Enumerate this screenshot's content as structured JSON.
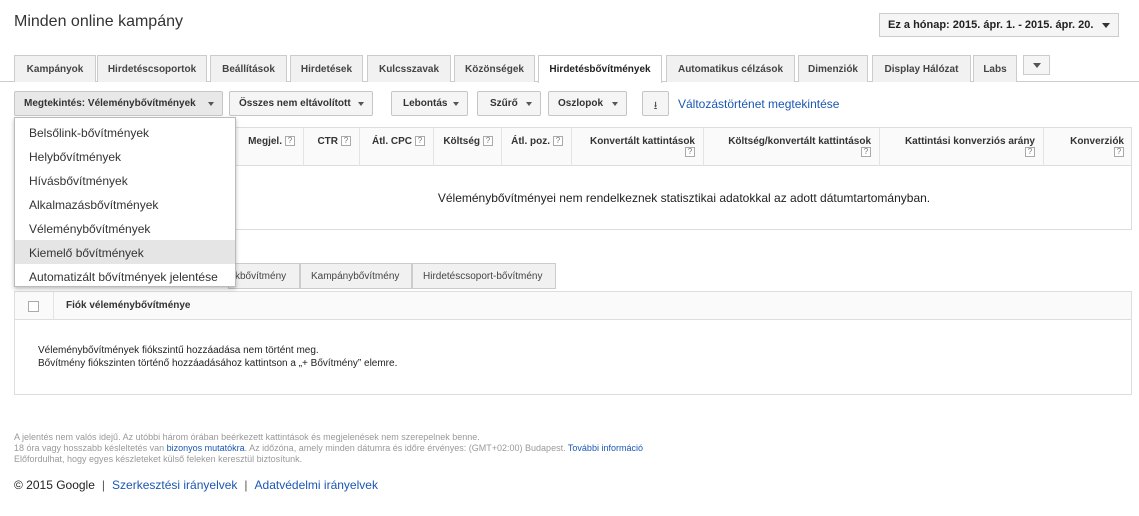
{
  "header": {
    "title": "Minden online kampány",
    "date_range": "Ez a hónap: 2015. ápr. 1. - 2015. ápr. 20."
  },
  "tabs": [
    {
      "label": "Kampányok"
    },
    {
      "label": "Hirdetéscsoportok"
    },
    {
      "label": "Beállítások"
    },
    {
      "label": "Hirdetések"
    },
    {
      "label": "Kulcsszavak"
    },
    {
      "label": "Közönségek"
    },
    {
      "label": "Hirdetésbővítmények",
      "active": true
    },
    {
      "label": "Automatikus célzások"
    },
    {
      "label": "Dimenziók"
    },
    {
      "label": "Display Hálózat"
    },
    {
      "label": "Labs"
    }
  ],
  "toolbar": {
    "view_button": "Megtekintés: Véleménybővítmények",
    "filter_all": "Összes nem eltávolított",
    "segment": "Lebontás",
    "filter": "Szűrő",
    "columns": "Oszlopok",
    "history_link": "Változástörténet megtekintése"
  },
  "view_menu": {
    "items": [
      "Belsőlink-bővítmények",
      "Helybővítmények",
      "Hívásbővítmények",
      "Alkalmazásbővítmények",
      "Véleménybővítmények",
      "Kiemelő bővítmények",
      "Automatizált bővítmények jelentése"
    ],
    "hovered": "Kiemelő bővítmények"
  },
  "stats_table": {
    "columns": [
      "Megjel.",
      "CTR",
      "Átl. CPC",
      "Költség",
      "Átl. poz.",
      "Konvertált kattintások",
      "Költség/konvertált kattintások",
      "Kattintási konverziós arány",
      "Konverziók"
    ],
    "empty_message": "Véleménybővítményei nem rendelkeznek statisztikai adatokkal az adott dátumtartományban."
  },
  "sub_tabs": [
    {
      "label": "kbővítmény"
    },
    {
      "label": "Kampánybővítmény"
    },
    {
      "label": "Hirdetéscsoport-bővítmény"
    }
  ],
  "account_table": {
    "column": "Fiók véleménybővítménye",
    "message_line1": "Véleménybővítmények fiókszintű hozzáadása nem történt meg.",
    "message_line2": "Bővítmény fiókszinten történő hozzáadásához kattintson a „+ Bővítmény” elemre."
  },
  "footer": {
    "note1": "A jelentés nem valós idejű. Az utóbbi három órában beérkezett kattintások és megjelenések nem szerepelnek benne.",
    "note2_prefix": "18 óra vagy hosszabb késleltetés van",
    "note2_link": "bizonyos mutatókra",
    "note2_suffix": ". Az időzóna, amely minden dátumra és időre érvényes: (GMT+02:00) Budapest.",
    "note2_link2": "További információ",
    "note3": "Előfordulhat, hogy egyes készleteket külső feleken keresztül biztosítunk.",
    "copyright": "© 2015 Google",
    "link_editorial": "Szerkesztési irányelvek",
    "link_privacy": "Adatvédelmi irányelvek",
    "separator": "|"
  }
}
